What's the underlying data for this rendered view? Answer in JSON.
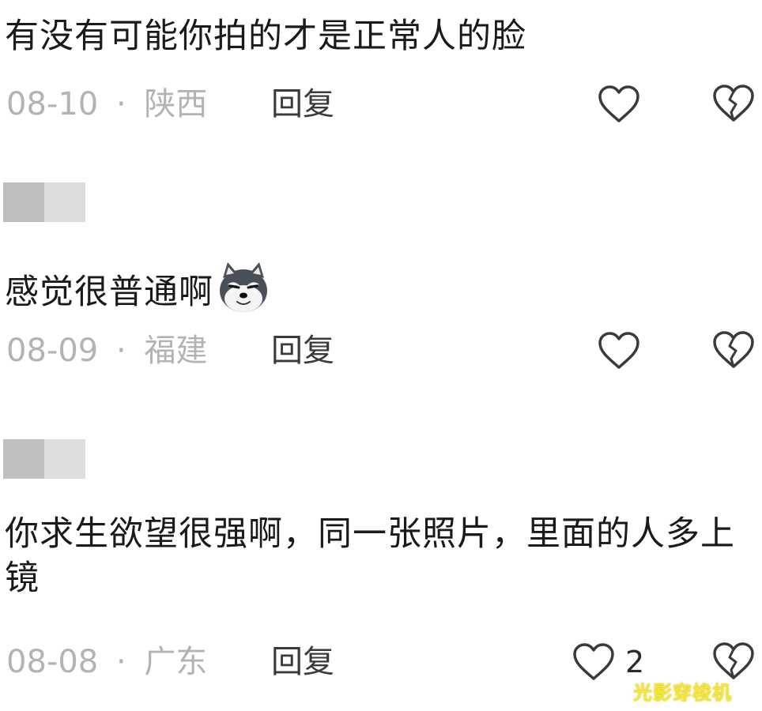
{
  "comments": [
    {
      "text": "有没有可能你拍的才是正常人的脸",
      "date": "08-10",
      "location": "陕西",
      "reply_label": "回复"
    },
    {
      "text": "感觉很普通啊",
      "emoji": "husky-dog-emoji",
      "date": "08-09",
      "location": "福建",
      "reply_label": "回复"
    },
    {
      "text": "你求生欲望很强啊，同一张照片，里面的人多上镜",
      "date": "08-08",
      "location": "广东",
      "reply_label": "回复",
      "like_count": "2"
    }
  ],
  "meta_separator": "·",
  "watermark": "光影穿梭机",
  "icons": {
    "like": "heart-outline-icon",
    "dislike": "broken-heart-icon"
  },
  "colors": {
    "text": "#1a1a1a",
    "meta": "#b3b3b3",
    "watermark": "#f5e63a"
  }
}
